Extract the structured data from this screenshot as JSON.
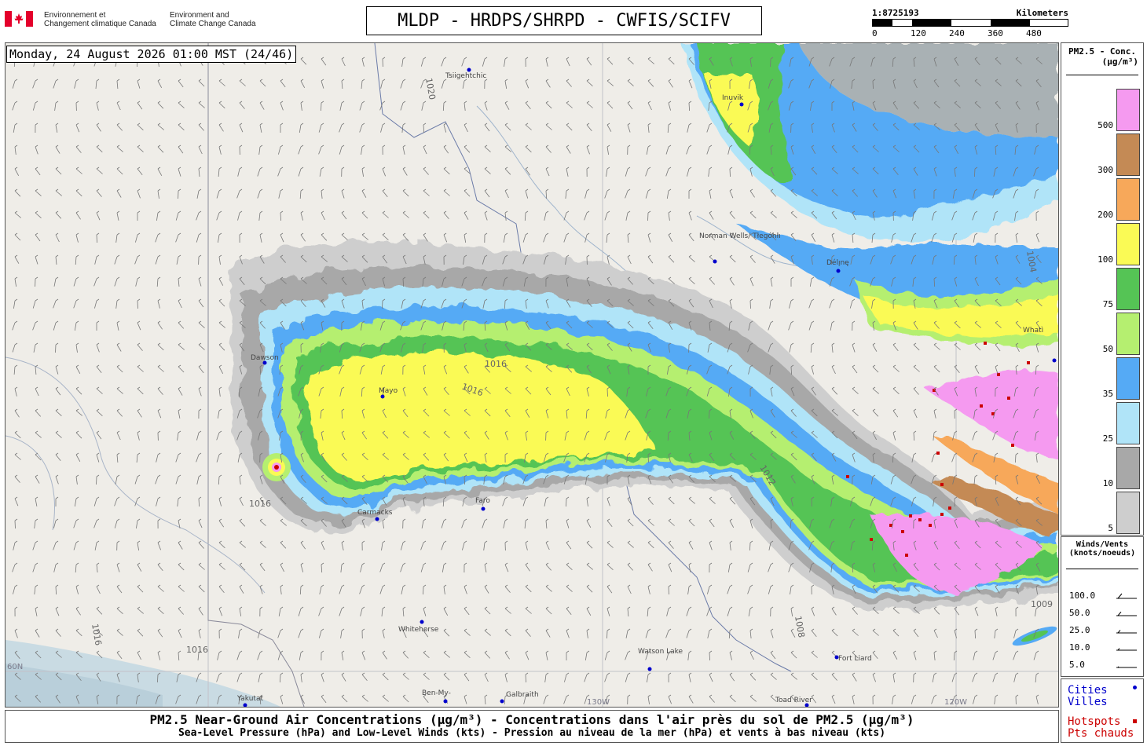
{
  "header": {
    "org_fr_line1": "Environnement et",
    "org_fr_line2": "Changement climatique Canada",
    "org_en_line1": "Environment and",
    "org_en_line2": "Climate Change Canada",
    "title": "MLDP - HRDPS/SHRPD - CWFIS/SCIFV"
  },
  "scalebar": {
    "ratio": "1:8725193",
    "unit": "Kilometers",
    "ticks": [
      "0",
      "120",
      "240",
      "360",
      "480"
    ]
  },
  "map": {
    "timestamp": "Monday, 24 August 2026 01:00 MST (24/46)",
    "places": [
      {
        "name": "Tsiigehtchic"
      },
      {
        "name": "Inuvik"
      },
      {
        "name": "Norman Wells/ Tłegóhłı"
      },
      {
        "name": "Délı̨nę"
      },
      {
        "name": "Dawson"
      },
      {
        "name": "Mayo"
      },
      {
        "name": "Carmacks"
      },
      {
        "name": "Faro"
      },
      {
        "name": "Whitehorse"
      },
      {
        "name": "Watson Lake"
      },
      {
        "name": "Fort Liard"
      },
      {
        "name": "Whatì"
      },
      {
        "name": "Yakutat"
      },
      {
        "name": "Ben-My-"
      },
      {
        "name": "Galbraith"
      },
      {
        "name": "Toad River"
      }
    ],
    "graticule_labels": [
      "60N",
      "130W",
      "120W"
    ],
    "isobar_labels": [
      "1016",
      "1012",
      "1008",
      "1004",
      "1009",
      "1020"
    ]
  },
  "legend_pm": {
    "title_line1": "PM2.5 - Conc.",
    "title_line2": "(µg/m³)",
    "bins": [
      {
        "label": "500",
        "color": "#f59af0"
      },
      {
        "label": "300",
        "color": "#c48a55"
      },
      {
        "label": "200",
        "color": "#f7a85a"
      },
      {
        "label": "100",
        "color": "#fafa55"
      },
      {
        "label": "75",
        "color": "#55c455"
      },
      {
        "label": "50",
        "color": "#b5ef70"
      },
      {
        "label": "35",
        "color": "#55aaf5"
      },
      {
        "label": "25",
        "color": "#b0e4f8"
      },
      {
        "label": "10",
        "color": "#a8a8a8"
      },
      {
        "label": "5",
        "color": "#cecece"
      }
    ]
  },
  "legend_wind": {
    "title_line1": "Winds/Vents",
    "title_line2": "(knots/noeuds)",
    "speeds": [
      "100.0",
      "50.0",
      "25.0",
      "10.0",
      "5.0"
    ]
  },
  "legend_cities": {
    "cities_en": "Cities",
    "cities_fr": "Villes",
    "hotspots_en": "Hotspots",
    "hotspots_fr": "Pts chauds",
    "city_color": "#0000cc",
    "hotspot_color": "#cc0000"
  },
  "caption": {
    "line1": "PM2.5 Near-Ground Air Concentrations (µg/m³) - Concentrations dans l'air près du sol de PM2.5 (µg/m³)",
    "line2": "Sea-Level Pressure (hPa) and Low-Level Winds (kts) - Pression au niveau de la mer (hPa) et vents à bas niveau (kts)"
  }
}
